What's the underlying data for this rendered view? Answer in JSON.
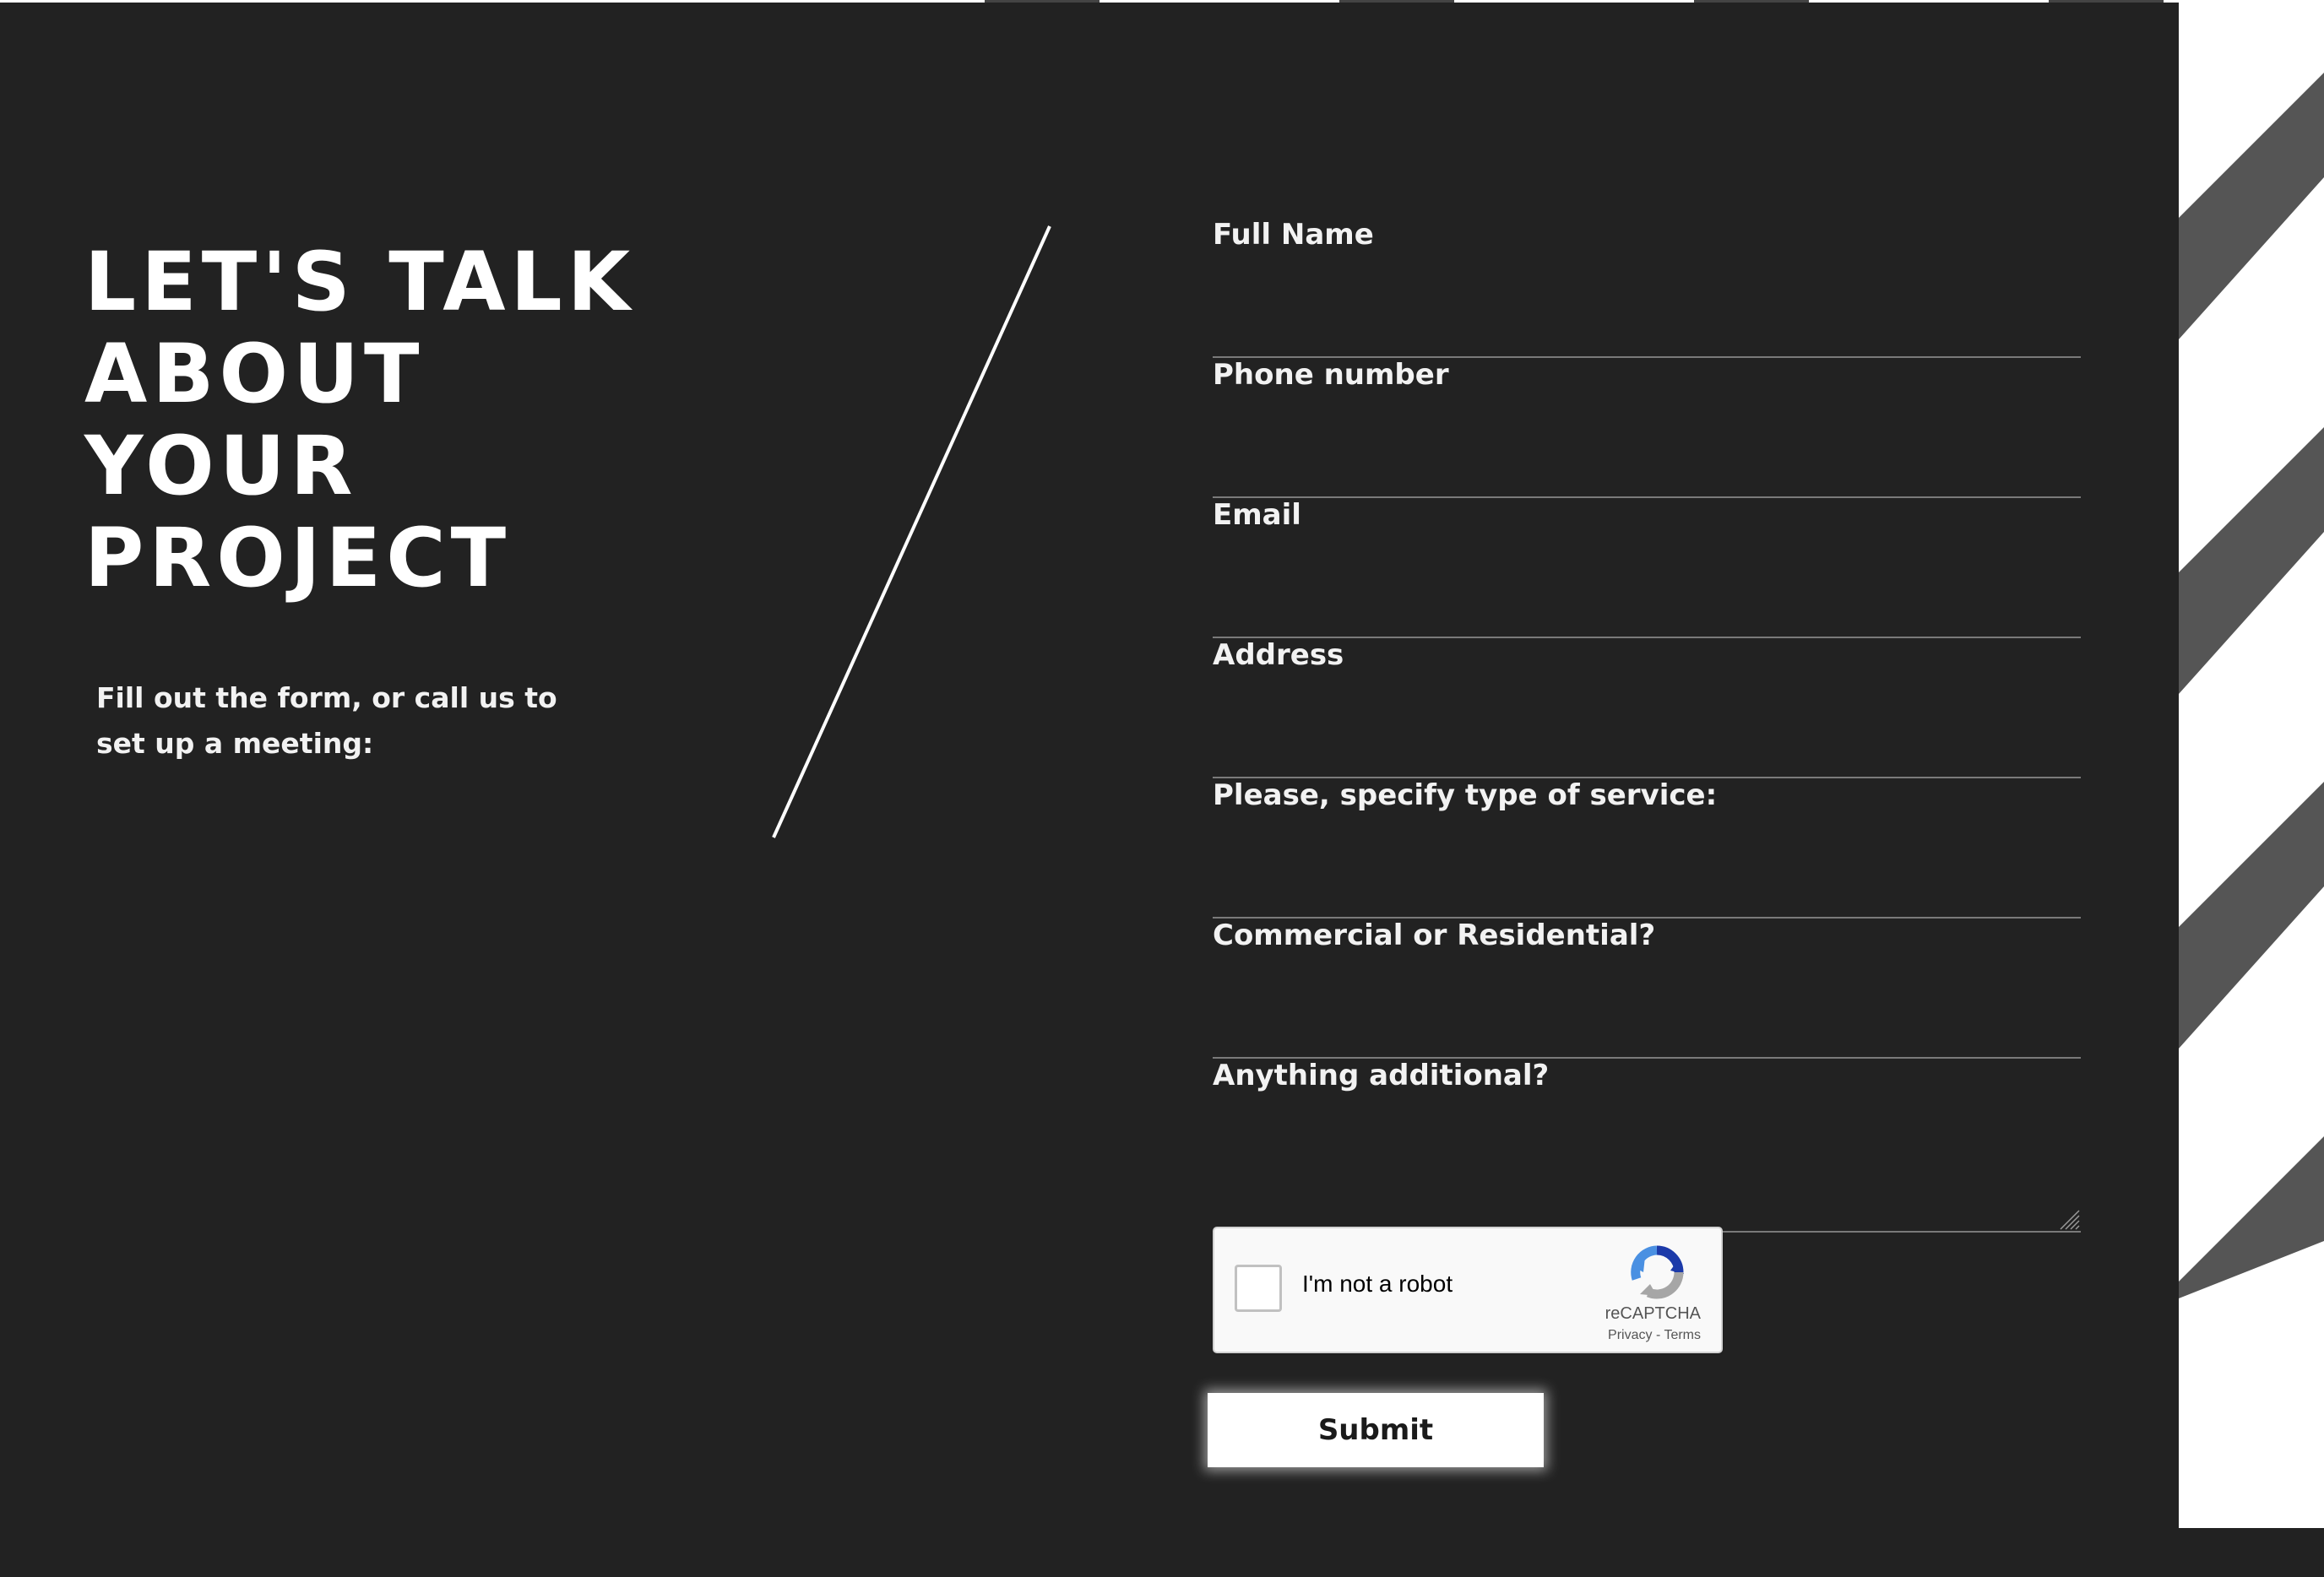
{
  "headline": "LET'S TALK ABOUT YOUR PROJECT",
  "intro": "Fill out the form, or call us to set up a meeting:",
  "form": {
    "fields": [
      {
        "label": "Full Name",
        "value": ""
      },
      {
        "label": "Phone number",
        "value": ""
      },
      {
        "label": "Email",
        "value": ""
      },
      {
        "label": "Address",
        "value": ""
      },
      {
        "label": "Please, specify type of service:",
        "value": ""
      },
      {
        "label": "Commercial or Residential?",
        "value": ""
      }
    ],
    "additional": {
      "label": "Anything additional?",
      "value": ""
    }
  },
  "captcha": {
    "label": "I'm not a robot",
    "brand": "reCAPTCHA",
    "privacy": "Privacy",
    "separator": " - ",
    "terms": "Terms",
    "checked": false
  },
  "submit_label": "Submit",
  "colors": {
    "background": "#222222",
    "text": "#ffffff",
    "stripe": "#555555",
    "field_underline": "#7a7a7a"
  }
}
